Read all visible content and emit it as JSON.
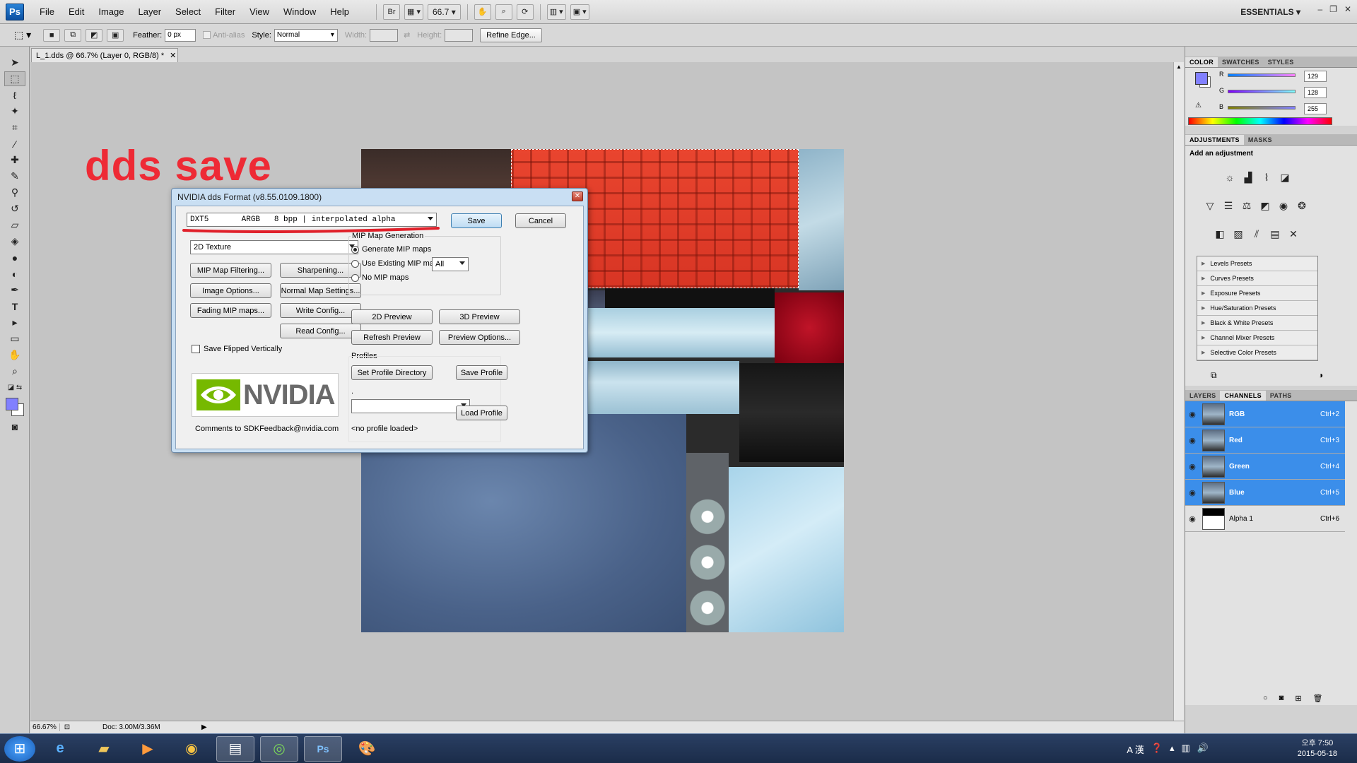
{
  "app": {
    "logo": "Ps",
    "menu": [
      "File",
      "Edit",
      "Image",
      "Layer",
      "Select",
      "Filter",
      "View",
      "Window",
      "Help"
    ],
    "bridge": "Br",
    "zoom": "66.7",
    "workspace": "ESSENTIALS"
  },
  "options": {
    "feather_label": "Feather:",
    "feather_value": "0 px",
    "antialias": "Anti-alias",
    "style_label": "Style:",
    "style_value": "Normal",
    "width_label": "Width:",
    "height_label": "Height:",
    "refine": "Refine Edge..."
  },
  "document": {
    "tab": "L_1.dds @ 66.7% (Layer 0, RGB/8) *",
    "zoom": "66.67%",
    "doc_size": "Doc: 3.00M/3.36M"
  },
  "annotation": "dds save",
  "dialog": {
    "title": "NVIDIA dds Format (v8.55.0109.1800)",
    "format_value": "DXT5       ARGB   8 bpp | interpolated alpha",
    "save": "Save",
    "cancel": "Cancel",
    "texture_type": "2D Texture",
    "buttons": {
      "mip_filtering": "MIP Map Filtering...",
      "sharpening": "Sharpening...",
      "image_options": "Image Options...",
      "normal_map": "Normal Map Settings...",
      "fading_mip": "Fading MIP maps...",
      "write_config": "Write Config...",
      "read_config": "Read Config..."
    },
    "save_flipped": "Save Flipped Vertically",
    "mip_group": "MIP Map Generation",
    "mip_options": [
      "Generate MIP maps",
      "Use Existing MIP maps",
      "No MIP maps"
    ],
    "mip_count": "All",
    "preview_2d": "2D Preview",
    "preview_3d": "3D Preview",
    "refresh": "Refresh Preview",
    "preview_options": "Preview Options...",
    "profiles_label": "Profiles",
    "set_profile_dir": "Set Profile Directory",
    "save_profile": "Save Profile",
    "load_profile": "Load Profile",
    "profile_dot": ".",
    "no_profile": "<no profile loaded>",
    "feedback": "Comments to SDKFeedback@nvidia.com",
    "nvidia_word": "NVIDIA"
  },
  "color_panel": {
    "tabs": [
      "COLOR",
      "SWATCHES",
      "STYLES"
    ],
    "r": "129",
    "g": "128",
    "b": "255",
    "r_label": "R",
    "g_label": "G",
    "b_label": "B",
    "fg_color": "#8180ff"
  },
  "adjust_panel": {
    "tabs": [
      "ADJUSTMENTS",
      "MASKS"
    ],
    "heading": "Add an adjustment",
    "presets": [
      "Levels Presets",
      "Curves Presets",
      "Exposure Presets",
      "Hue/Saturation Presets",
      "Black & White Presets",
      "Channel Mixer Presets",
      "Selective Color Presets"
    ]
  },
  "channels_panel": {
    "tabs": [
      "LAYERS",
      "CHANNELS",
      "PATHS"
    ],
    "rows": [
      {
        "name": "RGB",
        "shortcut": "Ctrl+2"
      },
      {
        "name": "Red",
        "shortcut": "Ctrl+3"
      },
      {
        "name": "Green",
        "shortcut": "Ctrl+4"
      },
      {
        "name": "Blue",
        "shortcut": "Ctrl+5"
      },
      {
        "name": "Alpha 1",
        "shortcut": "Ctrl+6"
      }
    ]
  },
  "taskbar": {
    "ime": "A 漢",
    "time": "오후 7:50",
    "date": "2015-05-18"
  },
  "colors": {
    "accent_red": "#ee2a35",
    "selection_blue": "#3b8eea"
  }
}
